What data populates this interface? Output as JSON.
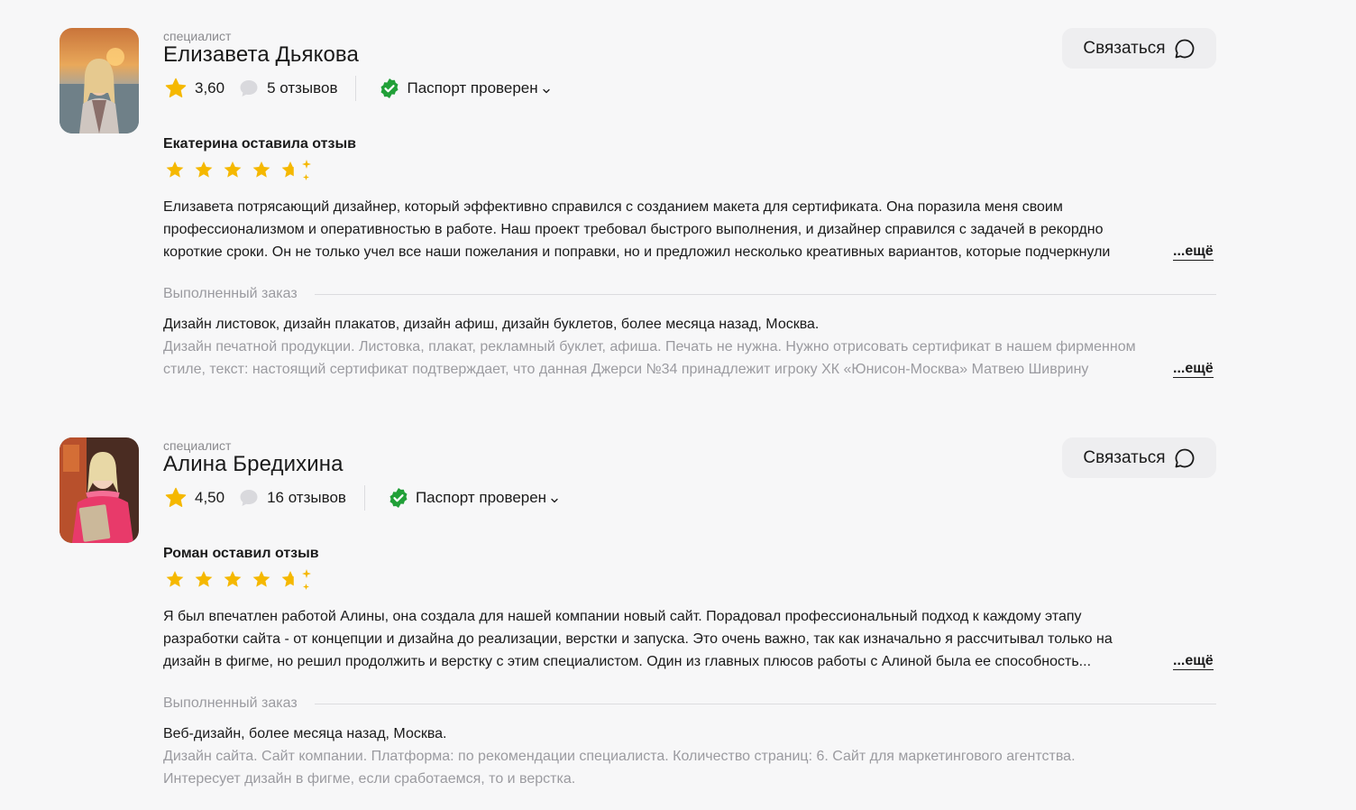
{
  "colors": {
    "accent_star": "#f5b800",
    "verified_green": "#21a038",
    "muted_text": "#9b9ba0",
    "button_bg": "#eeeef0"
  },
  "cards": [
    {
      "role": "специалист",
      "name": "Елизавета Дьякова",
      "rating": "3,60",
      "reviews_count": "5 отзывов",
      "passport": "Паспорт проверен",
      "contact_label": "Связаться",
      "reviewer": "Екатерина оставила отзыв",
      "stars_value": 4.5,
      "review_lines": [
        "Елизавета потрясающий дизайнер, который эффективно справился с созданием макета для сертификата. Она поразила меня своим",
        "профессионализмом и оперативностью в работе. Наш проект требовал быстрого выполнения, и дизайнер справился с задачей в рекордно",
        "короткие сроки. Он не только учел все наши пожелания и поправки, но и предложил несколько креативных вариантов, которые подчеркнули"
      ],
      "more_label": "...ещё",
      "order_label": "Выполненный заказ",
      "order_title": "Дизайн листовок, дизайн плакатов, дизайн афиш, дизайн буклетов, более месяца назад, Москва.",
      "order_lines": [
        "Дизайн печатной продукции. Листовка, плакат, рекламный буклет, афиша. Печать не нужна. Нужно отрисовать сертификат в нашем фирменном",
        "стиле, текст: настоящий сертификат подтверждает, что данная Джерси №34 принадлежит игроку ХК «Юнисон-Москва» Матвею Шиврину"
      ],
      "order_more_label": "...ещё"
    },
    {
      "role": "специалист",
      "name": "Алина Бредихина",
      "rating": "4,50",
      "reviews_count": "16 отзывов",
      "passport": "Паспорт проверен",
      "contact_label": "Связаться",
      "reviewer": "Роман оставил отзыв",
      "stars_value": 4.5,
      "review_lines": [
        "Я был впечатлен работой Алины, она создала для нашей компании новый сайт. Порадовал профессиональный подход к каждому этапу",
        "разработки сайта - от концепции и дизайна до реализации, верстки и запуска. Это очень важно, так как изначально я рассчитывал только на",
        "дизайн в фигме, но решил продолжить и верстку с этим специалистом. Один из главных плюсов работы с Алиной была ее способность..."
      ],
      "more_label": "...ещё",
      "order_label": "Выполненный заказ",
      "order_title": "Веб-дизайн, более месяца назад, Москва.",
      "order_lines": [
        "Дизайн сайта. Сайт компании. Платформа: по рекомендации специалиста. Количество страниц: 6. Сайт для маркетингового агентства.",
        "Интересует дизайн в фигме, если сработаемся, то и верстка."
      ]
    }
  ]
}
